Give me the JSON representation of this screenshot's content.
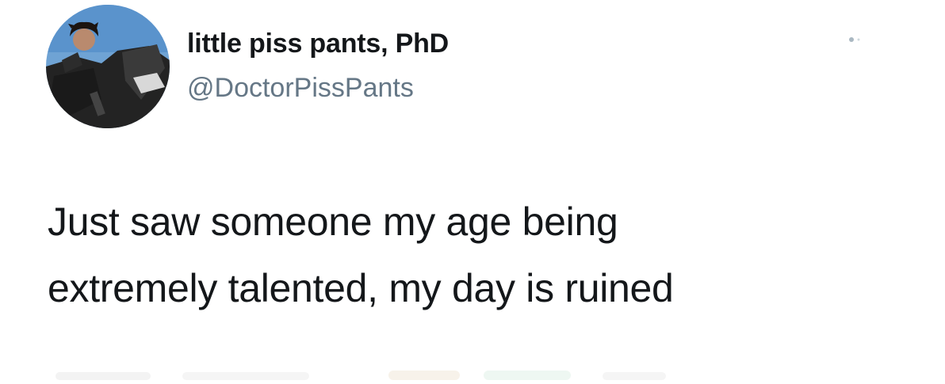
{
  "user": {
    "display_name": "little piss pants, PhD",
    "handle": "@DoctorPissPants",
    "avatar": "profile-photo"
  },
  "tweet": {
    "lines": [
      "Just saw someone my age being",
      "extremely talented, my day is ruined"
    ]
  },
  "menu": {
    "icon": "more-options-icon"
  },
  "colors": {
    "name": "#14171a",
    "handle": "#657786",
    "text": "#14171a",
    "background": "#ffffff"
  }
}
